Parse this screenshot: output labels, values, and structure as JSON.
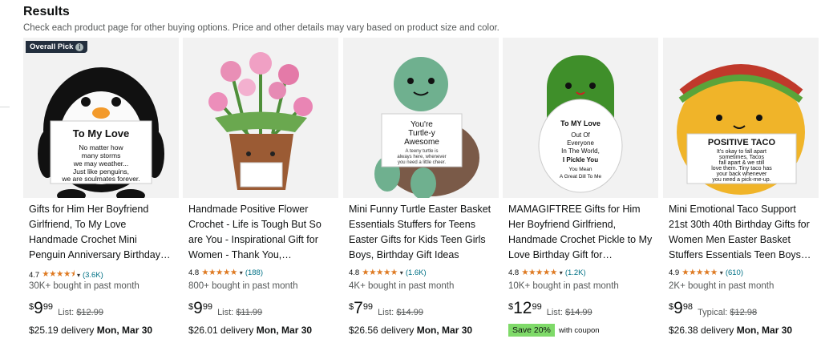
{
  "header": {
    "title": "Results",
    "subtitle": "Check each product page for other buying options. Price and other details may vary based on product size and color."
  },
  "products": [
    {
      "badge": "Overall Pick",
      "image_text": [
        "To My Love",
        "No matter how",
        "many storms",
        "we may weather...",
        "Just like penguins,",
        "we are soulmates forever."
      ],
      "title": "Gifts for Him Her Boyfriend Girlfriend, To My Love Handmade Crochet Mini Penguin Anniversary Birthday Gift",
      "rating": "4.7",
      "stars": "★★★★⯨",
      "reviews": "(3.6K)",
      "bought": "30K+ bought in past month",
      "price_symbol": "$",
      "price_whole": "9",
      "price_fraction": "99",
      "list_label": "List:",
      "list_price": "$12.99",
      "delivery_prefix": "$25.19 delivery",
      "delivery_date": "Mon, Mar 30"
    },
    {
      "title": "Handmade Positive Flower Crochet - Life is Tough But So are You - Inspirational Gift for Women - Thank You, Encouragement Gift",
      "rating": "4.8",
      "stars": "★★★★★",
      "reviews": "(188)",
      "bought": "800+ bought in past month",
      "price_symbol": "$",
      "price_whole": "9",
      "price_fraction": "99",
      "list_label": "List:",
      "list_price": "$11.99",
      "delivery_prefix": "$26.01 delivery",
      "delivery_date": "Mon, Mar 30"
    },
    {
      "image_text": [
        "You're",
        "Turtle-y",
        "Awesome",
        "A teeny turtle is",
        "always here, whenever",
        "you need a little cheer."
      ],
      "title": "Mini Funny Turtle Easter Basket Essentials Stuffers for Teens Easter Gifts for Kids Teen Girls Boys, Birthday Gift Ideas",
      "rating": "4.8",
      "stars": "★★★★★",
      "reviews": "(1.6K)",
      "bought": "4K+ bought in past month",
      "price_symbol": "$",
      "price_whole": "7",
      "price_fraction": "99",
      "list_label": "List:",
      "list_price": "$14.99",
      "delivery_prefix": "$26.56 delivery",
      "delivery_date": "Mon, Mar 30"
    },
    {
      "image_text": [
        "To MY Love",
        "Out Of",
        "Everyone",
        "In The World,",
        "I Pickle You",
        "You Mean",
        "A Great Dill To Me"
      ],
      "title": "MAMAGIFTREE Gifts for Him Her Boyfriend Girlfriend, Handmade Crochet Pickle to My Love Birthday Gift for Anniversary",
      "rating": "4.8",
      "stars": "★★★★★",
      "reviews": "(1.2K)",
      "bought": "10K+ bought in past month",
      "price_symbol": "$",
      "price_whole": "12",
      "price_fraction": "99",
      "list_label": "List:",
      "list_price": "$14.99",
      "save_badge": "Save 20%",
      "save_text": "with coupon"
    },
    {
      "image_text": [
        "POSITIVE TACO",
        "It's okay to fall apart",
        "sometimes, Tacos",
        "fall apart & we still",
        "love them. Tiny taco has",
        "your back whenever",
        "you need a pick-me-up."
      ],
      "title": "Mini Emotional Taco Support 21st 30th 40th Birthday Gifts for Women Men Easter Basket Stuffers Essentials Teen Boys Girls",
      "rating": "4.9",
      "stars": "★★★★★",
      "reviews": "(610)",
      "bought": "2K+ bought in past month",
      "price_symbol": "$",
      "price_whole": "9",
      "price_fraction": "98",
      "list_label": "Typical:",
      "list_price": "$12.98",
      "delivery_prefix": "$26.38 delivery",
      "delivery_date": "Mon, Mar 30"
    }
  ],
  "colors": {
    "star": "#de7921",
    "link": "#007185",
    "badge_bg": "#232f3e",
    "save_bg": "#7fda69"
  }
}
